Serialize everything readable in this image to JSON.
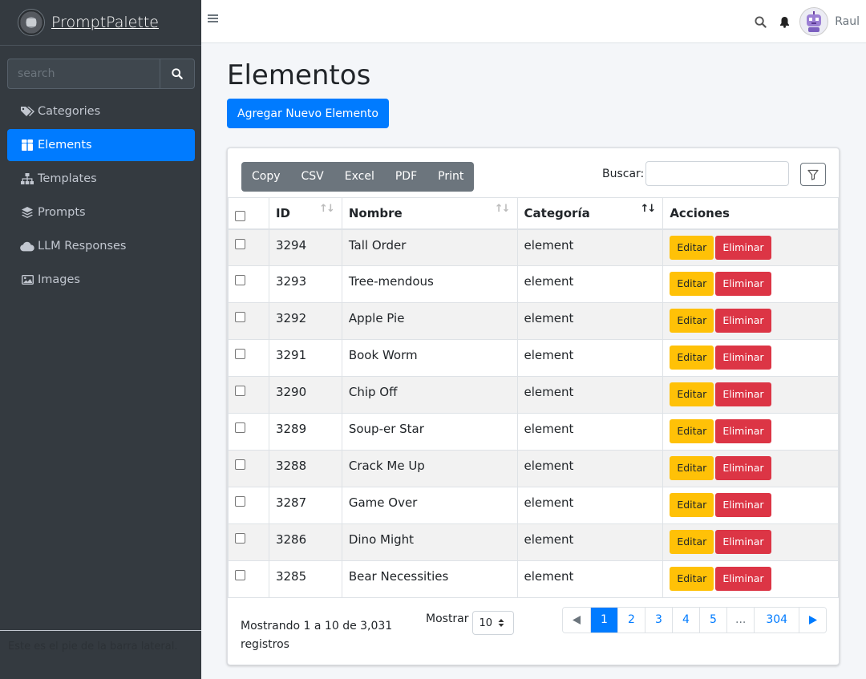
{
  "brand": {
    "name": "PromptPalette"
  },
  "sidebar": {
    "search_placeholder": "search",
    "items": [
      {
        "label": "Categories",
        "icon": "tags-icon",
        "active": false
      },
      {
        "label": "Elements",
        "icon": "boxes-icon",
        "active": true
      },
      {
        "label": "Templates",
        "icon": "sitemap-icon",
        "active": false
      },
      {
        "label": "Prompts",
        "icon": "layers-icon",
        "active": false
      },
      {
        "label": "LLM Responses",
        "icon": "cloud-icon",
        "active": false
      },
      {
        "label": "Images",
        "icon": "image-icon",
        "active": false
      }
    ],
    "footer": "Este es el pie de la barra lateral."
  },
  "topbar": {
    "user": "Raul"
  },
  "page": {
    "title": "Elementos",
    "add_button": "Agregar Nuevo Elemento"
  },
  "table_tools": {
    "exports": [
      "Copy",
      "CSV",
      "Excel",
      "PDF",
      "Print"
    ],
    "search_label": "Buscar:"
  },
  "table": {
    "headers": {
      "id": "ID",
      "name": "Nombre",
      "category": "Categoría",
      "actions": "Acciones"
    },
    "edit_label": "Editar",
    "delete_label": "Eliminar",
    "rows": [
      {
        "id": "3294",
        "name": "Tall Order",
        "category": "element"
      },
      {
        "id": "3293",
        "name": "Tree-mendous",
        "category": "element"
      },
      {
        "id": "3292",
        "name": "Apple Pie",
        "category": "element"
      },
      {
        "id": "3291",
        "name": "Book Worm",
        "category": "element"
      },
      {
        "id": "3290",
        "name": "Chip Off",
        "category": "element"
      },
      {
        "id": "3289",
        "name": "Soup-er Star",
        "category": "element"
      },
      {
        "id": "3288",
        "name": "Crack Me Up",
        "category": "element"
      },
      {
        "id": "3287",
        "name": "Game Over",
        "category": "element"
      },
      {
        "id": "3286",
        "name": "Dino Might",
        "category": "element"
      },
      {
        "id": "3285",
        "name": "Bear Necessities",
        "category": "element"
      }
    ]
  },
  "footer": {
    "info": "Mostrando 1 a 10 de 3,031 registros",
    "show_label": "Mostrar",
    "page_size": "10",
    "pages": [
      "1",
      "2",
      "3",
      "4",
      "5",
      "...",
      "304"
    ],
    "current_page": "1"
  },
  "colors": {
    "accent": "#007bff",
    "sidebar": "#343a40",
    "edit": "#ffc107",
    "delete": "#dc3545"
  }
}
